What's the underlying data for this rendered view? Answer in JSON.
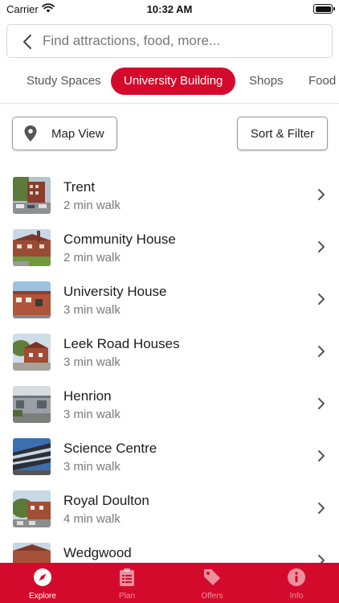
{
  "status_bar": {
    "carrier": "Carrier",
    "time": "10:32 AM"
  },
  "search": {
    "placeholder": "Find attractions, food, more..."
  },
  "categories": [
    {
      "label": "Study Spaces",
      "active": false
    },
    {
      "label": "University Building",
      "active": true
    },
    {
      "label": "Shops",
      "active": false
    },
    {
      "label": "Food",
      "active": false
    }
  ],
  "toolbar": {
    "map_view_label": "Map View",
    "sort_filter_label": "Sort & Filter"
  },
  "places": [
    {
      "name": "Trent",
      "walk": "2 min walk"
    },
    {
      "name": "Community House",
      "walk": "2 min walk"
    },
    {
      "name": "University House",
      "walk": "3 min walk"
    },
    {
      "name": "Leek Road Houses",
      "walk": "3 min walk"
    },
    {
      "name": "Henrion",
      "walk": "3 min walk"
    },
    {
      "name": "Science Centre",
      "walk": "3 min walk"
    },
    {
      "name": "Royal Doulton",
      "walk": "4 min walk"
    },
    {
      "name": "Wedgwood",
      "walk": ""
    }
  ],
  "tabbar": {
    "items": [
      {
        "label": "Explore",
        "icon": "compass-icon",
        "active": true
      },
      {
        "label": "Plan",
        "icon": "clipboard-icon",
        "active": false
      },
      {
        "label": "Offers",
        "icon": "tag-icon",
        "active": false
      },
      {
        "label": "Info",
        "icon": "info-icon",
        "active": false
      }
    ]
  },
  "colors": {
    "accent": "#d40a2c",
    "subtext": "#7a7a7a",
    "border": "#9a9a9a"
  }
}
